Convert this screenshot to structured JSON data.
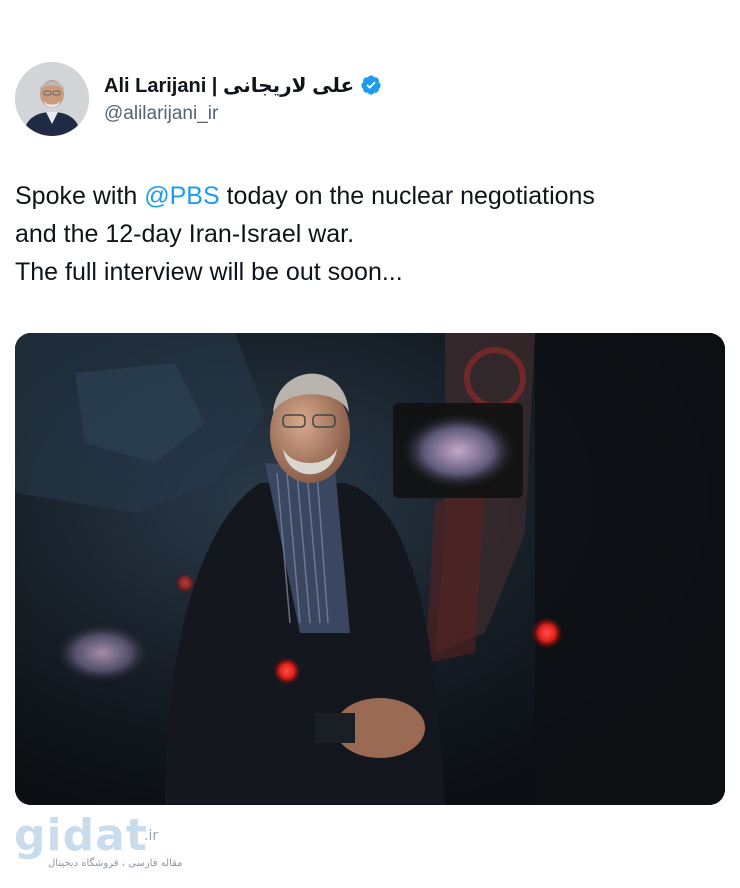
{
  "author": {
    "name": "Ali Larijani | علی لاریجانی",
    "handle": "@alilarijani_ir",
    "verified": true,
    "verified_color": "#1d9bf0"
  },
  "tweet": {
    "line1_pre": "Spoke with ",
    "mention": "@PBS",
    "line1_post": " today on the nuclear negotiations",
    "line2": "and the 12-day Iran-Israel war.",
    "line3": "The full interview will be out soon..."
  },
  "media": {
    "type": "photo",
    "image_alt": "photo-of-man-in-dark-suit-seated-in-interview-setting"
  },
  "watermark": {
    "logo": "gidat",
    "tld": ".ir",
    "tagline": "مقاله فارسی ، فروشگاه دیجیتال"
  },
  "colors": {
    "text": "#0f1419",
    "secondary": "#536471",
    "link": "#1d9bf0"
  }
}
